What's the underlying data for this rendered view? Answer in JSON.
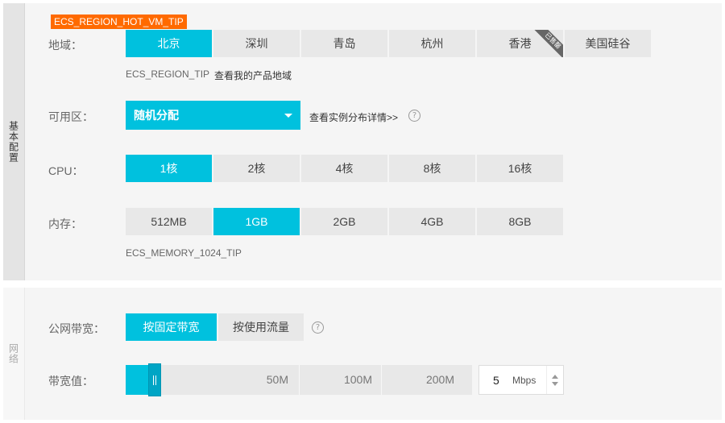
{
  "basic": {
    "side_title": "基本配置",
    "tip_tag": "ECS_REGION_HOT_VM_TIP",
    "region": {
      "label": "地域：",
      "options": [
        "北京",
        "深圳",
        "青岛",
        "杭州",
        "香港",
        "美国硅谷"
      ],
      "selected_index": 0,
      "sold_out_badge": "已售罄",
      "tip": "ECS_REGION_TIP",
      "link": "查看我的产品地域"
    },
    "zone": {
      "label": "可用区：",
      "selected": "随机分配",
      "link": "查看实例分布详情>>",
      "help_glyph": "?"
    },
    "cpu": {
      "label": "CPU：",
      "options": [
        "1核",
        "2核",
        "4核",
        "8核",
        "16核"
      ],
      "selected_index": 0
    },
    "memory": {
      "label": "内存：",
      "options": [
        "512MB",
        "1GB",
        "2GB",
        "4GB",
        "8GB"
      ],
      "selected_index": 1,
      "tip": "ECS_MEMORY_1024_TIP"
    }
  },
  "network": {
    "side_title": "网络",
    "billing": {
      "label": "公网带宽：",
      "options": [
        "按固定带宽",
        "按使用流量"
      ],
      "selected_index": 0,
      "help_glyph": "?"
    },
    "bandwidth": {
      "label": "带宽值：",
      "ticks": [
        "50M",
        "100M",
        "200M"
      ],
      "value": "5",
      "unit": "Mbps",
      "max": 200
    }
  },
  "colors": {
    "accent": "#00c1de",
    "tag": "#ff6a00"
  }
}
